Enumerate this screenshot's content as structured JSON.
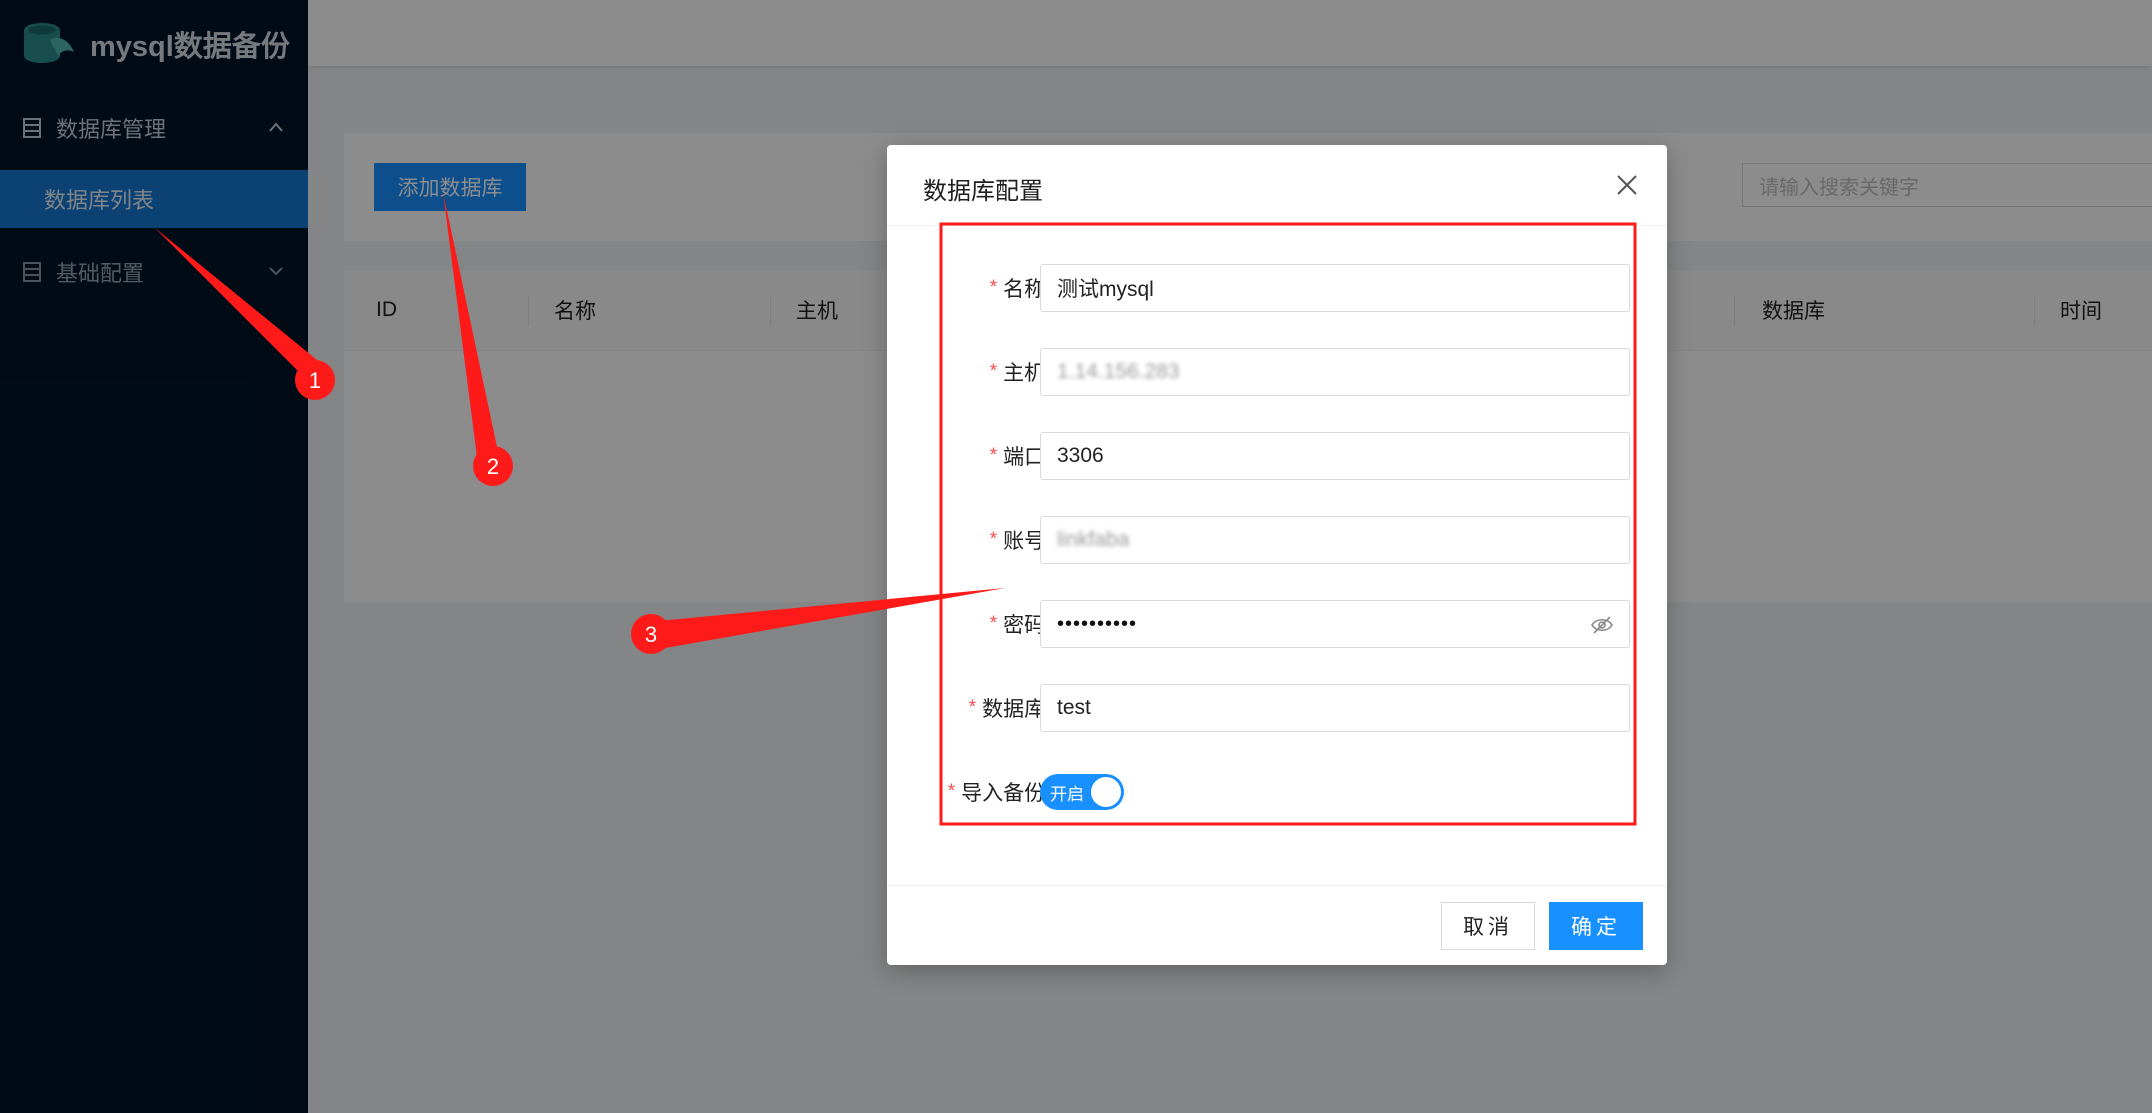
{
  "app": {
    "title": "mysql数据备份"
  },
  "sidebar": {
    "groups": [
      {
        "label": "数据库管理",
        "expanded": true,
        "items": [
          {
            "label": "数据库列表",
            "selected": true
          }
        ]
      },
      {
        "label": "基础配置",
        "expanded": false
      }
    ]
  },
  "toolbar": {
    "add_label": "添加数据库",
    "search_placeholder": "请输入搜索关键字"
  },
  "table": {
    "columns": [
      "ID",
      "名称",
      "主机",
      "数据库",
      "时间"
    ]
  },
  "modal": {
    "title": "数据库配置",
    "fields": [
      {
        "label": "名称:",
        "value": "测试mysql"
      },
      {
        "label": "主机:",
        "value": "1.14.156.283"
      },
      {
        "label": "端口:",
        "value": "3306"
      },
      {
        "label": "账号:",
        "value": "linkfaba"
      },
      {
        "label": "密码:",
        "value": "••••••••••"
      },
      {
        "label": "数据库:",
        "value": "test"
      },
      {
        "label": "导入备份:",
        "switch_on": true,
        "switch_text": "开启"
      }
    ],
    "cancel_label": "取消",
    "ok_label": "确定"
  },
  "annotations": {
    "badges": [
      "1",
      "2",
      "3"
    ],
    "color": "#ff1a1a"
  },
  "colors": {
    "primary": "#1890ff",
    "sidebar_bg": "#001529",
    "required": "#ff4d4f"
  }
}
